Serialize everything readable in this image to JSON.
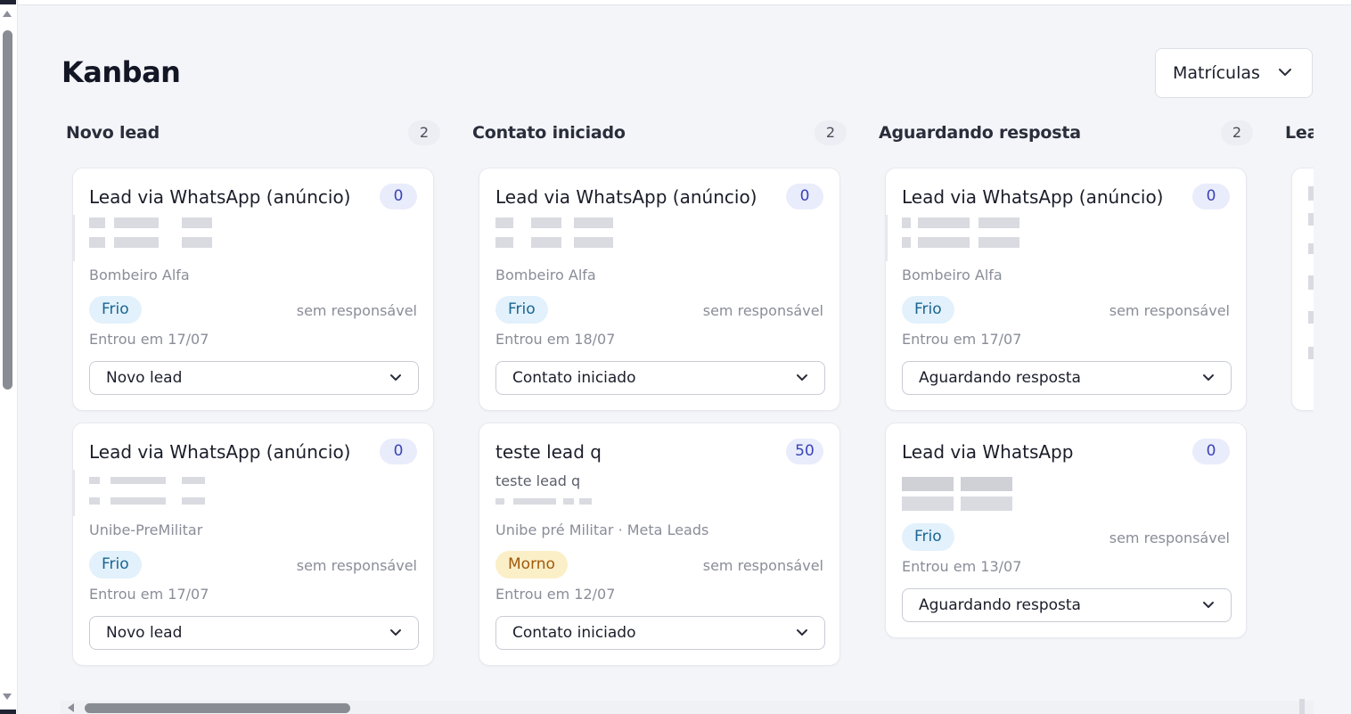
{
  "page": {
    "title": "Kanban"
  },
  "pipeline_select": {
    "value": "Matrículas"
  },
  "columns": [
    {
      "title": "Novo lead",
      "count": "2",
      "cards": [
        {
          "title": "Lead via WhatsApp (anúncio)",
          "score": "0",
          "source": "Bombeiro Alfa",
          "temperature": "Frio",
          "owner": "sem responsável",
          "entered": "Entrou em 17/07",
          "stage": "Novo lead"
        },
        {
          "title": "Lead via WhatsApp (anúncio)",
          "score": "0",
          "source": "Unibe-PreMilitar",
          "temperature": "Frio",
          "owner": "sem responsável",
          "entered": "Entrou em 17/07",
          "stage": "Novo lead"
        }
      ]
    },
    {
      "title": "Contato iniciado",
      "count": "2",
      "cards": [
        {
          "title": "Lead via WhatsApp (anúncio)",
          "score": "0",
          "source": "Bombeiro Alfa",
          "temperature": "Frio",
          "owner": "sem responsável",
          "entered": "Entrou em 18/07",
          "stage": "Contato iniciado"
        },
        {
          "title": "teste lead q",
          "score": "50",
          "subtitle": "teste lead q",
          "source": "Unibe pré Militar · Meta Leads",
          "temperature": "Morno",
          "owner": "sem responsável",
          "entered": "Entrou em 12/07",
          "stage": "Contato iniciado"
        }
      ]
    },
    {
      "title": "Aguardando resposta",
      "count": "2",
      "cards": [
        {
          "title": "Lead via WhatsApp (anúncio)",
          "score": "0",
          "source": "Bombeiro Alfa",
          "temperature": "Frio",
          "owner": "sem responsável",
          "entered": "Entrou em 17/07",
          "stage": "Aguardando resposta"
        },
        {
          "title": "Lead via WhatsApp",
          "score": "0",
          "temperature": "Frio",
          "owner": "sem responsável",
          "entered": "Entrou em 13/07",
          "stage": "Aguardando resposta"
        }
      ]
    },
    {
      "title": "Lea"
    }
  ],
  "icons": {
    "dropdown": "chevron-down-icon"
  },
  "colors": {
    "score_badge": "#e9ecfb",
    "frio_badge": "#e2f1fb",
    "morno_badge": "#fbefc8"
  }
}
